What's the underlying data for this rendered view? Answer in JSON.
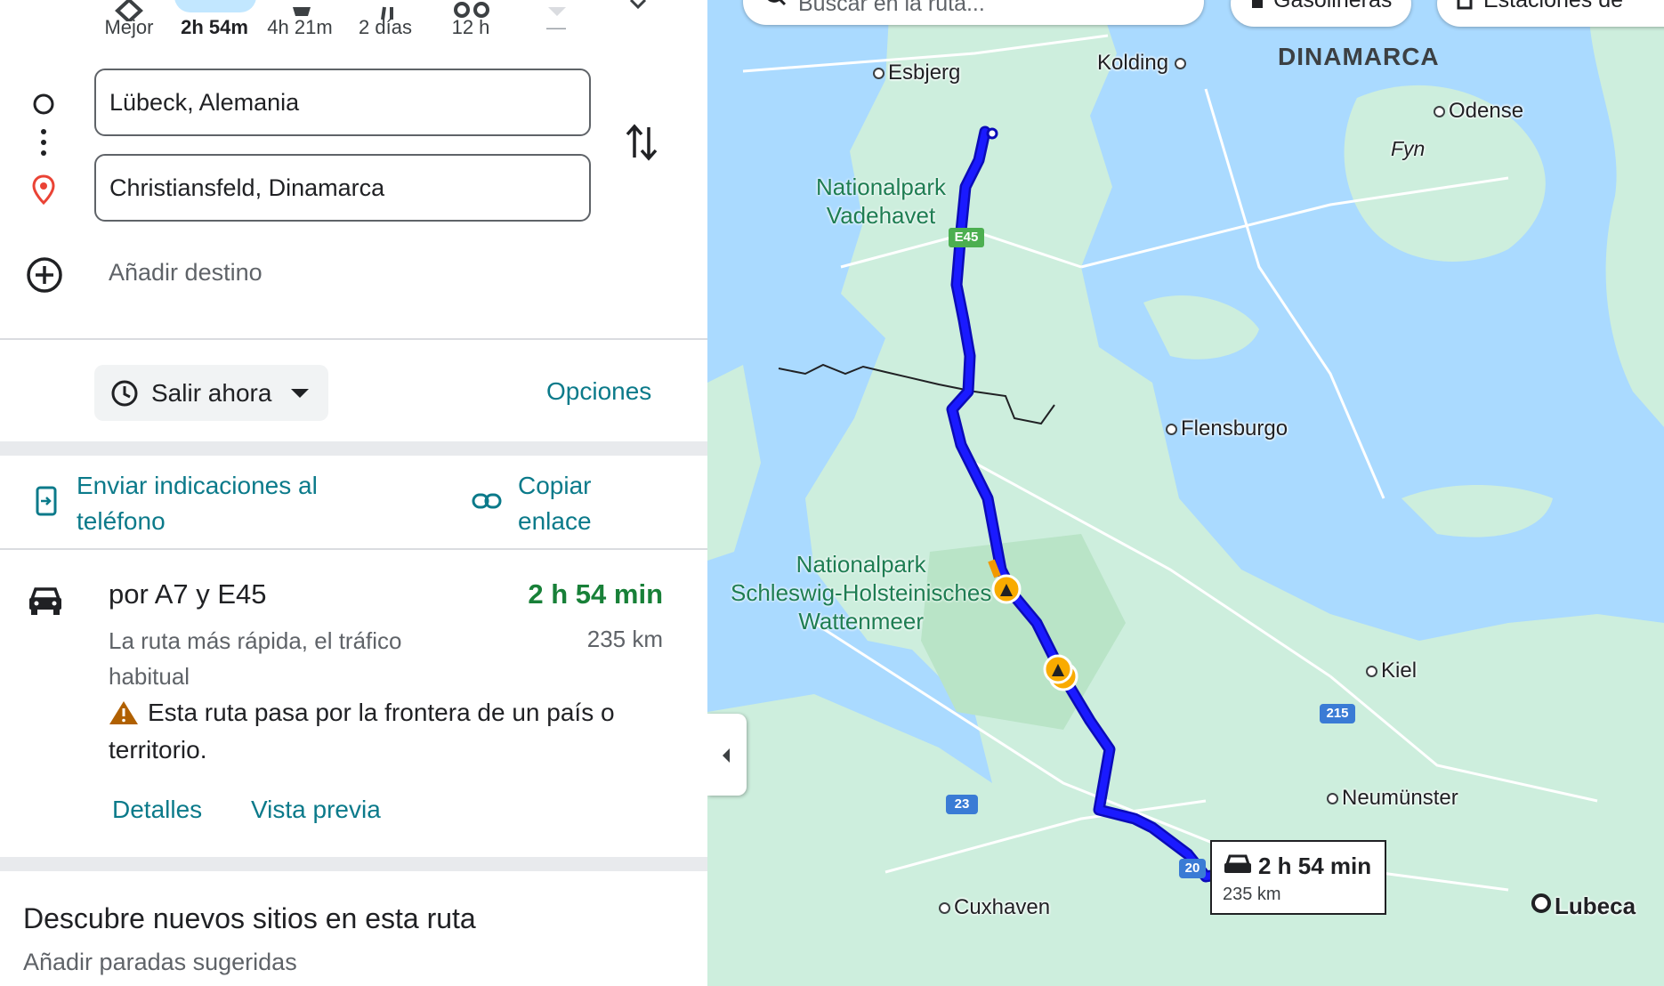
{
  "travel_modes": [
    {
      "label": "Mejor",
      "icon": "diamond-route-icon"
    },
    {
      "label": "2h 54m",
      "icon": "car-icon",
      "selected": true
    },
    {
      "label": "4h 21m",
      "icon": "train-icon"
    },
    {
      "label": "2 días",
      "icon": "walk-icon"
    },
    {
      "label": "12 h",
      "icon": "bicycle-icon"
    },
    {
      "label": "—",
      "icon": "flight-icon"
    }
  ],
  "origin": {
    "value": "Lübeck, Alemania"
  },
  "destination": {
    "value": "Christiansfeld, Dinamarca"
  },
  "add_destination": "Añadir destino",
  "depart": {
    "label": "Salir ahora"
  },
  "options": "Opciones",
  "send_to_phone": {
    "line1": "Enviar indicaciones al",
    "line2": "teléfono"
  },
  "copy_link": {
    "line1": "Copiar",
    "line2": "enlace"
  },
  "route": {
    "via": "por A7 y E45",
    "duration": "2 h 54 min",
    "distance": "235 km",
    "desc_line1": "La ruta más rápida, el tráfico",
    "desc_line2": "habitual",
    "warning_line1": "Esta ruta pasa por la frontera de un país o",
    "warning_line2": "territorio.",
    "details": "Detalles",
    "preview": "Vista previa"
  },
  "discover": {
    "title": "Descubre nuevos sitios en esta ruta",
    "subtitle": "Añadir paradas sugeridas"
  },
  "map": {
    "search_placeholder": "Buscar en la ruta...",
    "chips": [
      "Gasolineras",
      "Estaciones de"
    ],
    "country": "DINAMARCA",
    "cities": [
      "Esbjerg",
      "Kolding",
      "Odense",
      "Fyn",
      "Flensburgo",
      "Kiel",
      "Neumünster",
      "Cuxhaven",
      "Lubeca"
    ],
    "parks": [
      {
        "lines": [
          "Nationalpark",
          "Vadehavet"
        ]
      },
      {
        "lines": [
          "Nationalpark",
          "Schleswig-Holsteinisches",
          "Wattenmeer"
        ]
      }
    ],
    "road_shields": [
      "E45",
      "215",
      "23",
      "20"
    ],
    "callout": {
      "duration": "2 h 54 min",
      "distance": "235 km"
    },
    "colors": {
      "route": "#1a1aff",
      "water": "#aadaff",
      "land": "#cdeedd",
      "warning": "#f9ab00"
    }
  }
}
